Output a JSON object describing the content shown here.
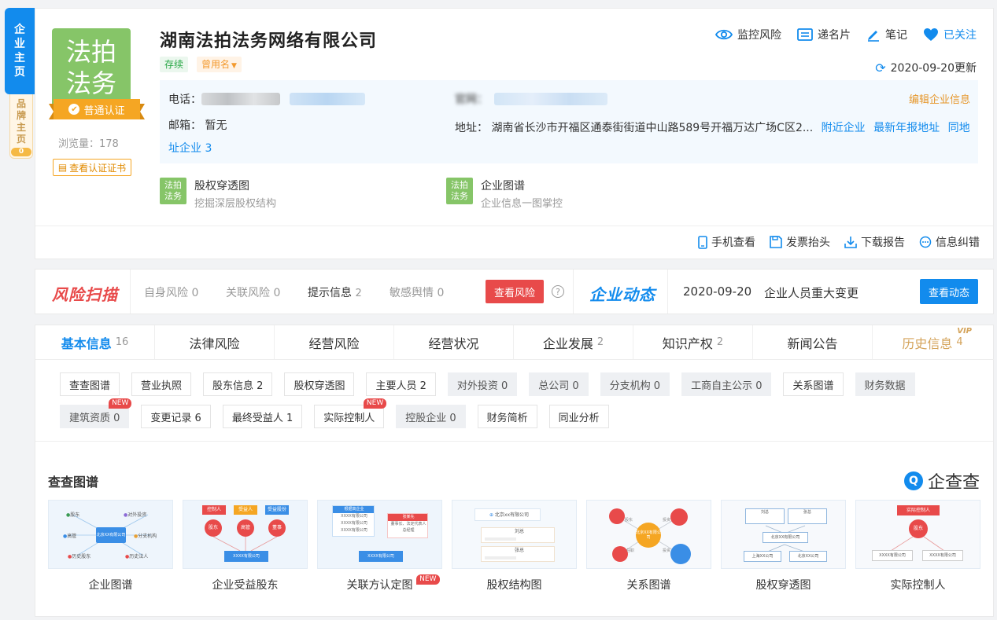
{
  "side_tabs": {
    "main": [
      "企",
      "业",
      "主",
      "页"
    ],
    "brand": [
      "品",
      "牌",
      "主",
      "页"
    ],
    "brand_count": "0"
  },
  "company": {
    "logo_lines": [
      "法拍",
      "法务"
    ],
    "cert_badge": "普通认证",
    "views_label": "浏览量：178",
    "cert_button": "查看认证证书",
    "name": "湖南法拍法务网络有限公司",
    "status_tag": "存续",
    "former_name_tag": "曾用名"
  },
  "top_actions": {
    "monitor": "监控风险",
    "card": "递名片",
    "note": "笔记",
    "follow": "已关注"
  },
  "update_text": "2020-09-20更新",
  "info": {
    "phone_label": "电话：",
    "website_label": "官网：",
    "email_label": "邮箱：",
    "email_value": "暂无",
    "address_label": "地址：",
    "address_value": "湖南省长沙市开福区通泰街街道中山路589号开福万达广场C区2...",
    "nearby": "附近企业",
    "annual_addr": "最新年报地址",
    "same_addr": "同地",
    "same_addr_2": "址企业 3",
    "edit": "编辑企业信息"
  },
  "quick_links": [
    {
      "logo": [
        "法拍",
        "法务"
      ],
      "title": "股权穿透图",
      "sub": "挖掘深层股权结构"
    },
    {
      "logo": [
        "法拍",
        "法务"
      ],
      "title": "企业图谱",
      "sub": "企业信息一图掌控"
    }
  ],
  "bottom_actions": {
    "mobile": "手机查看",
    "invoice": "发票抬头",
    "download": "下载报告",
    "correct": "信息纠错"
  },
  "risk": {
    "title": "风险扫描",
    "self": "自身风险 0",
    "related": "关联风险 0",
    "tips": "提示信息",
    "tips_count": "2",
    "sentiment": "敏感舆情 0",
    "button": "查看风险",
    "help": "?"
  },
  "dynamics": {
    "title": "企业动态",
    "date": "2020-09-20",
    "text": "企业人员重大变更",
    "button": "查看动态"
  },
  "tabs": [
    {
      "label": "基本信息",
      "count": "16"
    },
    {
      "label": "法律风险",
      "count": ""
    },
    {
      "label": "经营风险",
      "count": ""
    },
    {
      "label": "经营状况",
      "count": ""
    },
    {
      "label": "企业发展",
      "count": "2"
    },
    {
      "label": "知识产权",
      "count": "2"
    },
    {
      "label": "新闻公告",
      "count": ""
    },
    {
      "label": "历史信息",
      "count": "4",
      "badge": "VIP"
    }
  ],
  "chips": [
    {
      "label": "查查图谱"
    },
    {
      "label": "营业执照"
    },
    {
      "label": "股东信息 2"
    },
    {
      "label": "股权穿透图"
    },
    {
      "label": "主要人员 2"
    },
    {
      "label": "对外投资 0"
    },
    {
      "label": "总公司 0"
    },
    {
      "label": "分支机构 0"
    },
    {
      "label": "工商自主公示 0"
    },
    {
      "label": "关系图谱"
    },
    {
      "label": "财务数据"
    },
    {
      "label": "建筑资质 0",
      "badge": "NEW"
    },
    {
      "label": "变更记录 6"
    },
    {
      "label": "最终受益人 1"
    },
    {
      "label": "实际控制人",
      "badge": "NEW"
    },
    {
      "label": "控股企业 0"
    },
    {
      "label": "财务简析"
    },
    {
      "label": "同业分析"
    }
  ],
  "graph_section": {
    "title": "查查图谱",
    "brand_icon": "Q",
    "brand": "企查查"
  },
  "graphs": [
    {
      "label": "企业图谱",
      "nodes": [
        "股东",
        "对外投资",
        "高管",
        "北京XX有限公司",
        "分支机构",
        "历史股东",
        "历史法人"
      ]
    },
    {
      "label": "企业受益股东",
      "nodes": [
        "控制人",
        "受益人",
        "受益股份",
        "股东",
        "高管",
        "董事",
        "XXXX有限公司"
      ]
    },
    {
      "label": "关联方认定图",
      "badge": "NEW",
      "nodes": [
        "根据高企业",
        "XXXX有限公司",
        "XXXX有限公司",
        "XXXX有限公司",
        "张某先",
        "董事长、法定代表人",
        "总经理",
        "XXXX有限公司"
      ]
    },
    {
      "label": "股权结构图",
      "nodes": [
        "北京xx有限公司",
        "刘总",
        "张总"
      ]
    },
    {
      "label": "关系图谱",
      "nodes": [
        "北京XX有限公司",
        "股东",
        "投资",
        "任职",
        "投资"
      ]
    },
    {
      "label": "股权穿透图",
      "nodes": [
        "刘总",
        "张总",
        "北京XX有限公司",
        "上海XX公司",
        "北京XX公司"
      ]
    },
    {
      "label": "实际控制人",
      "nodes": [
        "实际控制人",
        "股东",
        "XXXX有限公司",
        "XXXX有限公司"
      ]
    }
  ],
  "colors": {
    "primary": "#128bed",
    "risk": "#e84a4a",
    "success": "#28a745",
    "gold": "#f5a623",
    "logo_green": "#86c568"
  }
}
